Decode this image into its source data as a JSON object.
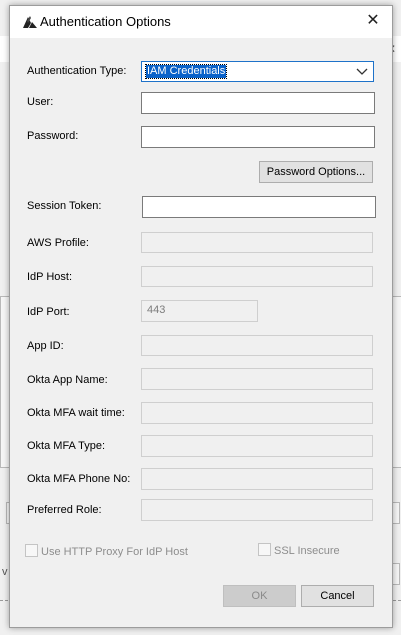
{
  "dialog": {
    "title": "Authentication Options",
    "close_glyph": "✕"
  },
  "background": {
    "close_glyph": "✕",
    "stray_letter": "v"
  },
  "fields": {
    "auth_type": {
      "label": "Authentication Type:",
      "value": "IAM Credentials"
    },
    "user": {
      "label": "User:",
      "value": ""
    },
    "password": {
      "label": "Password:",
      "value": ""
    },
    "session_token": {
      "label": "Session Token:",
      "value": ""
    },
    "aws_profile": {
      "label": "AWS Profile:",
      "value": ""
    },
    "idp_host": {
      "label": "IdP Host:",
      "value": ""
    },
    "idp_port": {
      "label": "IdP Port:",
      "value": "443"
    },
    "app_id": {
      "label": "App ID:",
      "value": ""
    },
    "okta_app_name": {
      "label": "Okta App Name:",
      "value": ""
    },
    "okta_mfa_wait": {
      "label": "Okta MFA wait time:",
      "value": ""
    },
    "okta_mfa_type": {
      "label": "Okta MFA Type:",
      "value": ""
    },
    "okta_mfa_phone": {
      "label": "Okta MFA Phone No:",
      "value": ""
    },
    "preferred_role": {
      "label": "Preferred Role:",
      "value": ""
    }
  },
  "buttons": {
    "password_options": "Password Options...",
    "ok": "OK",
    "cancel": "Cancel"
  },
  "checkboxes": {
    "http_proxy": {
      "label": "Use HTTP Proxy For IdP Host",
      "checked": false
    },
    "ssl_insecure": {
      "label": "SSL Insecure",
      "checked": false
    }
  },
  "colors": {
    "selection": "#0a62c9",
    "focus_border": "#1e72c9",
    "dialog_bg": "#f0f0f0"
  },
  "icons": {
    "app": "aws-logo-icon",
    "close": "close-icon",
    "dropdown": "chevron-down-icon"
  }
}
